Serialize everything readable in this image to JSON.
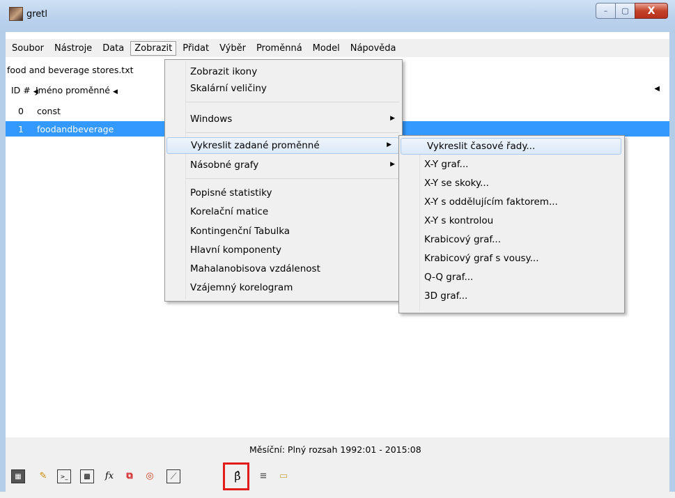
{
  "window": {
    "title": "gretl",
    "minimize": "–",
    "maximize": "▢",
    "close": "X"
  },
  "menubar": {
    "items": [
      {
        "label": "Soubor"
      },
      {
        "label": "Nástroje"
      },
      {
        "label": "Data"
      },
      {
        "label": "Zobrazit"
      },
      {
        "label": "Přidat"
      },
      {
        "label": "Výběr"
      },
      {
        "label": "Proměnná"
      },
      {
        "label": "Model"
      },
      {
        "label": "Nápověda"
      }
    ],
    "active": "Zobrazit"
  },
  "dataset": {
    "filename": "food and beverage stores.txt"
  },
  "table": {
    "headers": {
      "id": "ID #",
      "name": "Jméno proměnné"
    },
    "rows": [
      {
        "id": "0",
        "name": "const"
      },
      {
        "id": "1",
        "name": "foodandbeverage"
      }
    ],
    "selected_row": 1
  },
  "view_menu": {
    "items": [
      {
        "label": "Zobrazit ikony"
      },
      {
        "label": "Skalární veličiny"
      },
      {
        "label": "Windows"
      },
      {
        "label": "Vykreslit zadané proměnné"
      },
      {
        "label": "Násobné grafy"
      },
      {
        "label": "Popisné statistiky"
      },
      {
        "label": "Korelační matice"
      },
      {
        "label": "Kontingenční Tabulka"
      },
      {
        "label": "Hlavní komponenty"
      },
      {
        "label": "Mahalanobisova vzdálenost"
      },
      {
        "label": "Vzájemný korelogram"
      }
    ]
  },
  "plot_submenu": {
    "items": [
      {
        "label": "Vykreslit časové řady..."
      },
      {
        "label": "X-Y graf..."
      },
      {
        "label": "X-Y se skoky..."
      },
      {
        "label": "X-Y s oddělujícím faktorem..."
      },
      {
        "label": "X-Y s kontrolou"
      },
      {
        "label": "Krabicový graf..."
      },
      {
        "label": "Krabicový graf s vousy..."
      },
      {
        "label": "Q-Q graf..."
      },
      {
        "label": "3D graf..."
      }
    ]
  },
  "status": {
    "text": "Měsíční: Plný rozsah 1992:01 - 2015:08"
  },
  "toolbar": {
    "icons": [
      {
        "name": "calculator-icon",
        "glyph": "▦"
      },
      {
        "name": "edit-script-icon",
        "glyph": "✎"
      },
      {
        "name": "console-icon",
        "glyph": ">_"
      },
      {
        "name": "session-icon-view-icon",
        "glyph": "▩"
      },
      {
        "name": "function-icon",
        "glyph": "fx"
      },
      {
        "name": "pdf-guide-icon",
        "glyph": "⧉"
      },
      {
        "name": "help-icon",
        "glyph": "◎"
      },
      {
        "name": "plot-icon",
        "glyph": "⟋"
      },
      {
        "name": "beta-model-icon",
        "glyph": "β̂"
      },
      {
        "name": "database-icon",
        "glyph": "≡"
      },
      {
        "name": "open-folder-icon",
        "glyph": "▭"
      }
    ]
  },
  "colors": {
    "selection": "#3399ff",
    "highlight_box": "#e21b1b",
    "titlebar": "#b9d1ec"
  }
}
